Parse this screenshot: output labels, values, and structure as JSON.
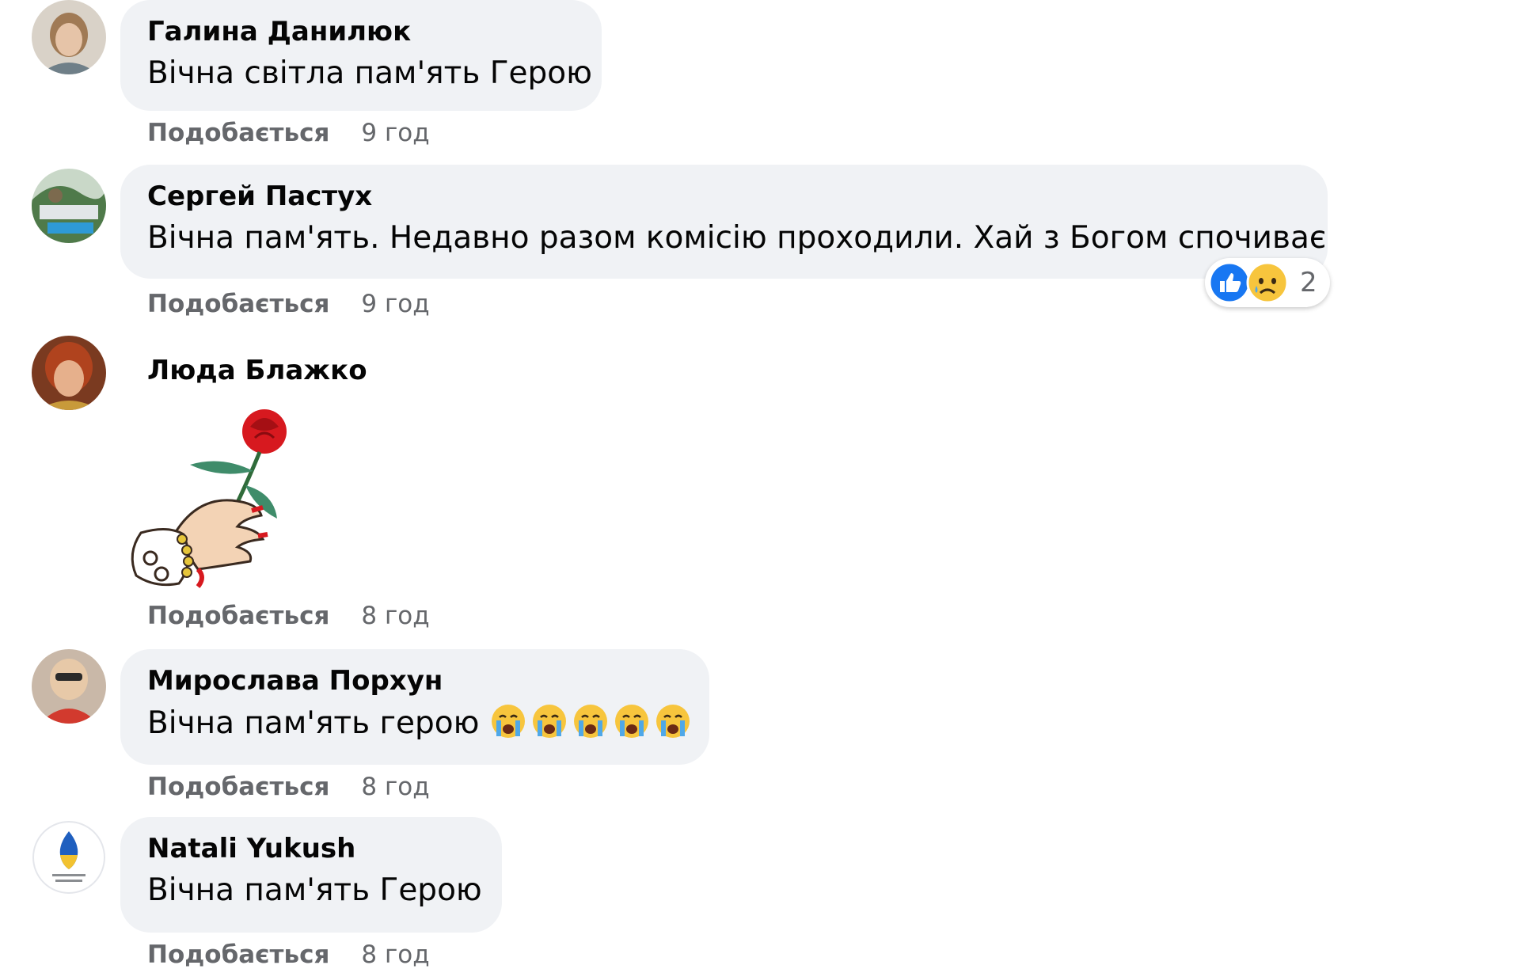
{
  "comments": [
    {
      "author": "Галина Данилюк",
      "text": "Вічна світла пам'ять Герою",
      "like_label": "Подобається",
      "time": "9 год"
    },
    {
      "author": "Сергей Пастух",
      "text": "Вічна пам'ять. Недавно разом комісію проходили. Хай з Богом спочиває",
      "like_label": "Подобається",
      "time": "9 год",
      "reactions": {
        "icons": [
          "like-reaction",
          "sad-reaction"
        ],
        "count": "2",
        "like_color": "#1877f2"
      }
    },
    {
      "author": "Люда Блажко",
      "sticker": "rose-in-hand-sticker",
      "like_label": "Подобається",
      "time": "8 год"
    },
    {
      "author": "Мирослава Порхун",
      "text": "Вічна пам'ять герою",
      "emojis": [
        "crying-face",
        "crying-face",
        "crying-face",
        "crying-face",
        "crying-face"
      ],
      "like_label": "Подобається",
      "time": "8 год"
    },
    {
      "author": "Natali Yukush",
      "text": "Вічна пам'ять Герою",
      "like_label": "Подобається",
      "time": "8 год"
    }
  ],
  "colors": {
    "bubble": "#f0f2f5",
    "secondary_text": "#65676b",
    "primary_text": "#050505"
  }
}
